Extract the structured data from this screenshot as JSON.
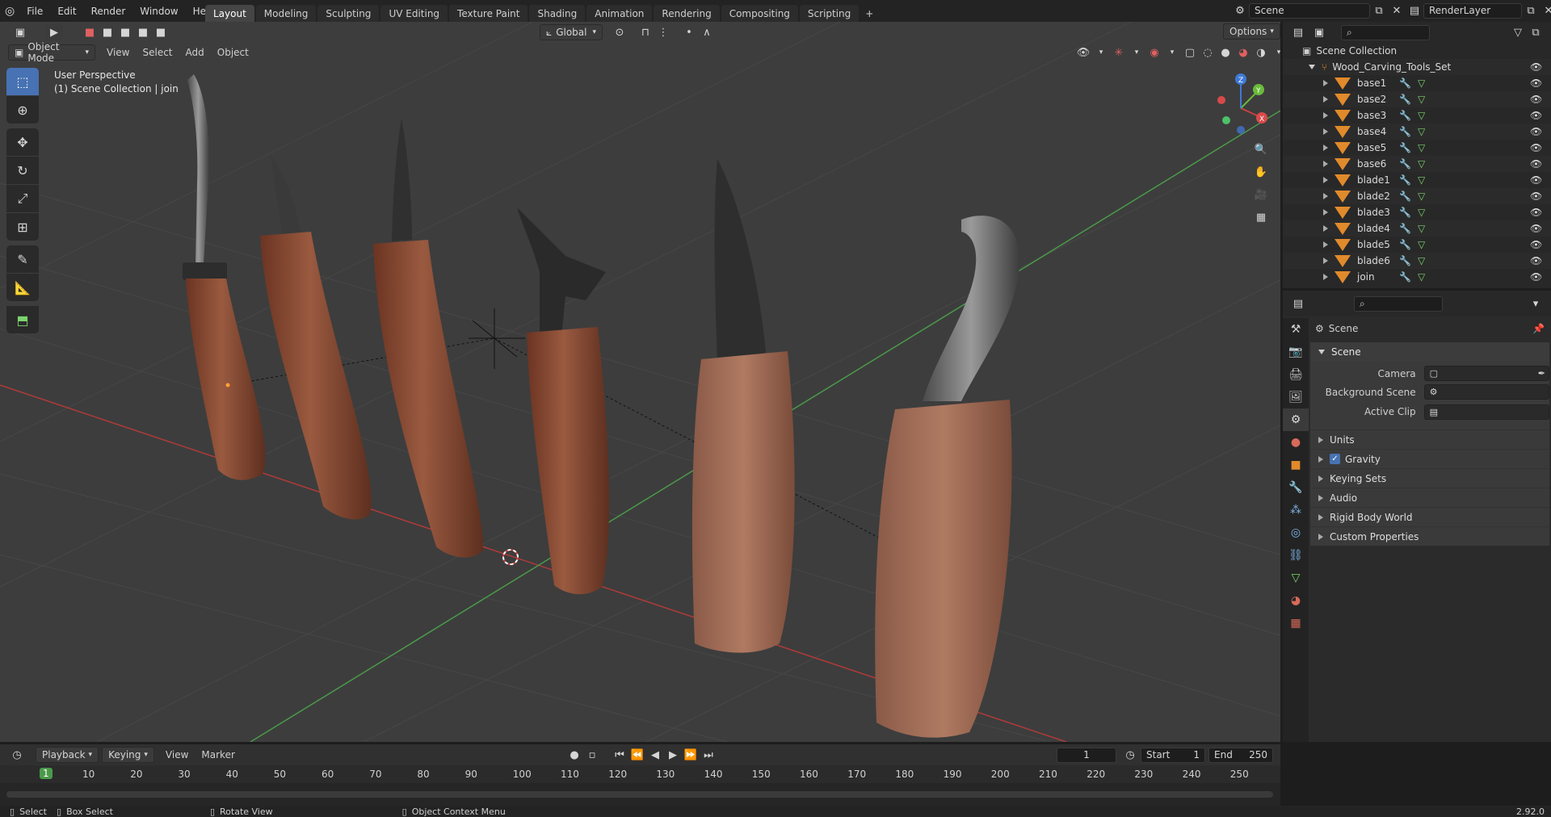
{
  "top_menu": [
    "File",
    "Edit",
    "Render",
    "Window",
    "Help"
  ],
  "workspace_tabs": [
    "Layout",
    "Modeling",
    "Sculpting",
    "UV Editing",
    "Texture Paint",
    "Shading",
    "Animation",
    "Rendering",
    "Compositing",
    "Scripting"
  ],
  "active_tab": "Layout",
  "add_tab_symbol": "+",
  "scene_field": "Scene",
  "view_layer_field": "RenderLayer",
  "viewport": {
    "mode": "Object Mode",
    "menus": [
      "View",
      "Select",
      "Add",
      "Object"
    ],
    "transform_orientation": "Global",
    "options_label": "Options",
    "overlay_line1": "User Perspective",
    "overlay_line2": "(1) Scene Collection | join",
    "gizmo": {
      "x": "X",
      "y": "Y",
      "z": "Z"
    }
  },
  "outliner": {
    "root": "Scene Collection",
    "collection": "Wood_Carving_Tools_Set",
    "objects": [
      "base1",
      "base2",
      "base3",
      "base4",
      "base5",
      "base6",
      "blade1",
      "blade2",
      "blade3",
      "blade4",
      "blade5",
      "blade6",
      "join"
    ]
  },
  "properties": {
    "header": "Scene",
    "panel": "Scene",
    "fields": [
      {
        "label": "Camera",
        "value": ""
      },
      {
        "label": "Background Scene",
        "value": ""
      },
      {
        "label": "Active Clip",
        "value": ""
      }
    ],
    "subpanels": [
      "Units",
      "Gravity",
      "Keying Sets",
      "Audio",
      "Rigid Body World",
      "Custom Properties"
    ],
    "gravity_checked": true
  },
  "timeline": {
    "menus": [
      "Playback",
      "Keying",
      "View",
      "Marker"
    ],
    "current_frame": "1",
    "start_label": "Start",
    "start_value": "1",
    "end_label": "End",
    "end_value": "250",
    "ticks": [
      "1",
      "10",
      "20",
      "30",
      "40",
      "50",
      "60",
      "70",
      "80",
      "90",
      "100",
      "110",
      "120",
      "130",
      "140",
      "150",
      "160",
      "170",
      "180",
      "190",
      "200",
      "210",
      "220",
      "230",
      "240",
      "250"
    ]
  },
  "statusbar": {
    "select": "Select",
    "box_select": "Box Select",
    "rotate_view": "Rotate View",
    "context_menu": "Object Context Menu",
    "version": "2.92.0"
  },
  "colors": {
    "accent": "#4772b3",
    "object_orange": "#e08a2c",
    "x_axis": "#b03a3a",
    "y_axis": "#4a9a4a"
  }
}
